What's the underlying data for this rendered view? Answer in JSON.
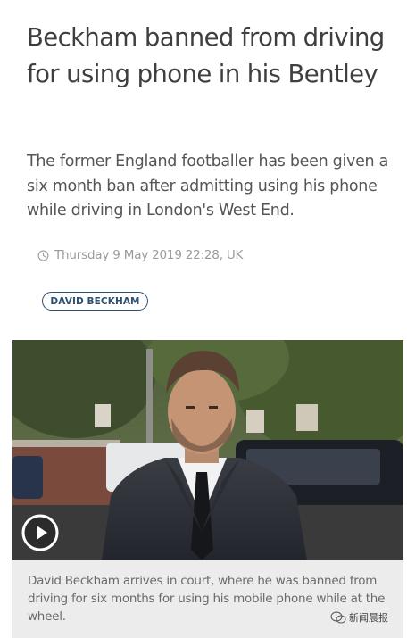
{
  "article": {
    "headline": "Beckham banned from driving for using phone in his Bentley",
    "standfirst": "The former England footballer has been given a six month ban after admitting using his phone while driving in London's West End.",
    "timestamp": "Thursday 9 May 2019 22:28, UK",
    "tag": "DAVID BECKHAM",
    "caption": "David Beckham arrives in court, where he was banned from driving for six months for using his mobile phone while at the wheel."
  },
  "media": {
    "play_icon": "play-icon"
  },
  "watermark": {
    "label": "新闻晨报"
  },
  "colors": {
    "headline": "#3f3f3f",
    "tag_border": "#2d4f74",
    "caption_bg": "#ececec"
  }
}
